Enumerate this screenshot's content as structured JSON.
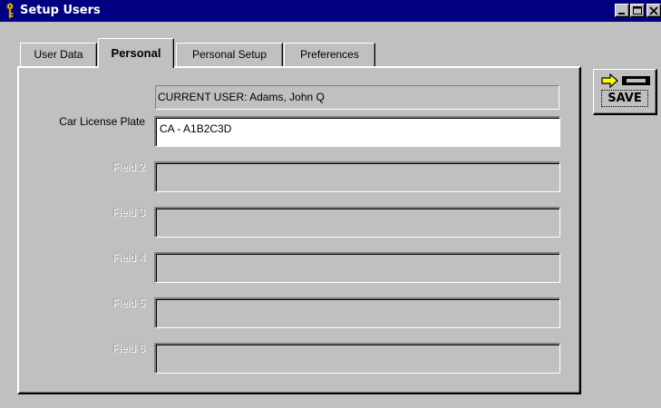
{
  "window": {
    "title": "Setup Users"
  },
  "icons": {
    "title": "key-icon",
    "minimize": "minimize-icon",
    "maximize": "maximize-icon",
    "close": "close-icon",
    "save": "arrow-disk-icon"
  },
  "tabs": [
    {
      "label": "User Data",
      "active": false
    },
    {
      "label": "Personal",
      "active": true
    },
    {
      "label": "Personal Setup",
      "active": false
    },
    {
      "label": "Preferences",
      "active": false
    }
  ],
  "current_user": "CURRENT USER:  Adams, John Q",
  "fields": [
    {
      "label": "Car License Plate",
      "value": "CA - A1B2C3D",
      "enabled": true
    },
    {
      "label": "Field 2",
      "value": "",
      "enabled": false
    },
    {
      "label": "Field 3",
      "value": "",
      "enabled": false
    },
    {
      "label": "Field 4",
      "value": "",
      "enabled": false
    },
    {
      "label": "Field 5",
      "value": "",
      "enabled": false
    },
    {
      "label": "Field 6",
      "value": "",
      "enabled": false
    }
  ],
  "save_button": {
    "label": "SAVE"
  },
  "colors": {
    "title_bar": "#000080",
    "window_face": "#c0c0c0",
    "arrow": "#ffff00",
    "disabled_text": "#a0a0a0"
  }
}
